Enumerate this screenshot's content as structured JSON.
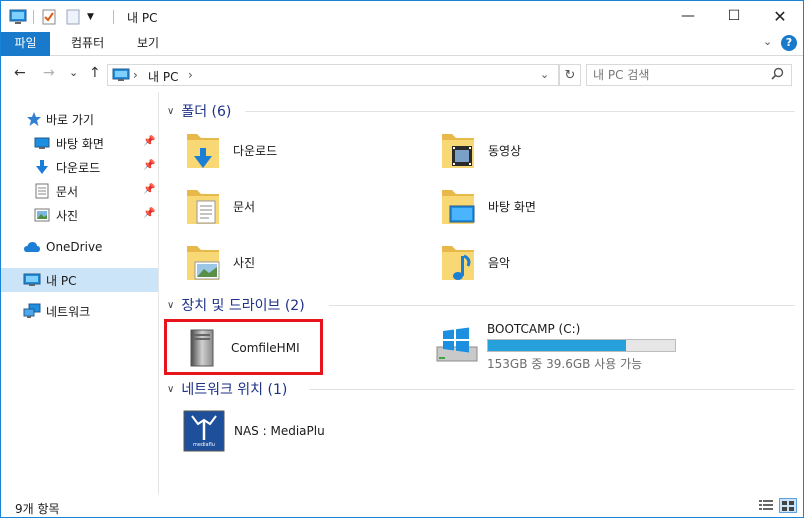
{
  "window": {
    "title": "내 PC"
  },
  "ribbon": {
    "tabs": [
      "파일",
      "컴퓨터",
      "보기"
    ]
  },
  "nav": {
    "back": "←",
    "forward": "→",
    "recent": "⌄",
    "up": "↑",
    "address": "내 PC",
    "address_sep1": "›",
    "address_sep2": "›",
    "search_placeholder": "내 PC 검색"
  },
  "sidebar": {
    "quick_access": "바로 가기",
    "items": [
      {
        "label": "바탕 화면",
        "icon": "desktop-icon",
        "pinned": true
      },
      {
        "label": "다운로드",
        "icon": "download-icon",
        "pinned": true
      },
      {
        "label": "문서",
        "icon": "documents-icon",
        "pinned": true
      },
      {
        "label": "사진",
        "icon": "pictures-icon",
        "pinned": true
      }
    ],
    "onedrive": "OneDrive",
    "this_pc": "내 PC",
    "network": "네트워크"
  },
  "content": {
    "folders_header": "폴더 (6)",
    "folders": [
      "다운로드",
      "동영상",
      "문서",
      "바탕 화면",
      "사진",
      "음악"
    ],
    "drives_header": "장치 및 드라이브 (2)",
    "drives": [
      {
        "name": "ComfileHMI"
      },
      {
        "name": "BOOTCAMP (C:)",
        "detail": "153GB 중 39.6GB 사용 가능",
        "used_fraction": 0.74
      }
    ],
    "network_header": "네트워크 위치 (1)",
    "network_items": [
      {
        "name": "NAS : MediaPlu",
        "logo_text": "mediaflu"
      }
    ]
  },
  "status": {
    "count": "9개 항목"
  },
  "colors": {
    "accent": "#1979ca",
    "folder": "#f8d775",
    "highlight": "#e8141c",
    "meter": "#26a0da"
  }
}
